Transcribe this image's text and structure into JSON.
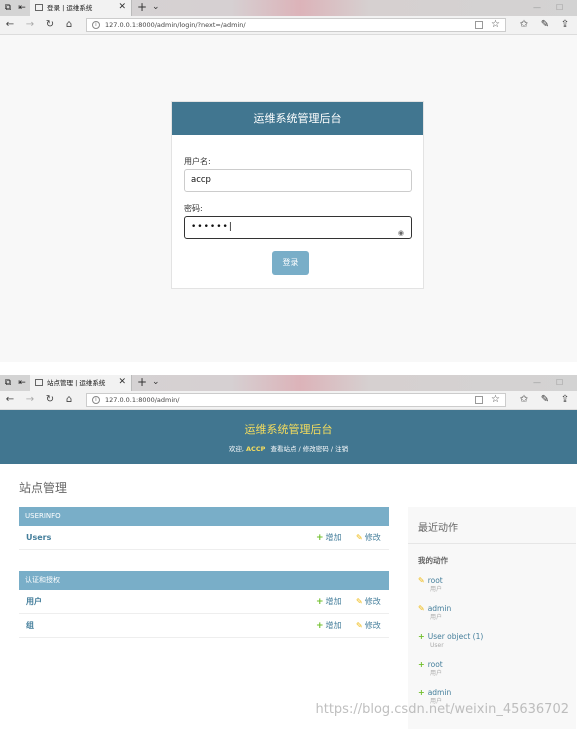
{
  "screen1": {
    "tab_title": "登录 | 运维系统",
    "url": "127.0.0.1:8000/admin/login/?next=/admin/",
    "login": {
      "header_title": "运维系统管理后台",
      "username_label": "用户名:",
      "username_value": "accp",
      "password_label": "密码:",
      "password_value": "••••••",
      "submit_label": "登录"
    }
  },
  "screen2": {
    "tab_title": "站点管理 | 运维系统",
    "url": "127.0.0.1:8000/admin/",
    "header": {
      "branding": "运维系统管理后台",
      "welcome": "欢迎,",
      "username": "ACCP",
      "view_site": "查看站点",
      "change_password": "修改密码",
      "logout": "注销",
      "separator": " / "
    },
    "page_title": "站点管理",
    "modules": [
      {
        "caption": "USERINFO",
        "models": [
          {
            "name": "Users",
            "add": "增加",
            "change": "修改"
          }
        ]
      },
      {
        "caption": "认证和授权",
        "models": [
          {
            "name": "用户",
            "add": "增加",
            "change": "修改"
          },
          {
            "name": "组",
            "add": "增加",
            "change": "修改"
          }
        ]
      }
    ],
    "recent": {
      "title": "最近动作",
      "subtitle": "我的动作",
      "actions": [
        {
          "kind": "change",
          "name": "root",
          "type": "用户"
        },
        {
          "kind": "change",
          "name": "admin",
          "type": "用户"
        },
        {
          "kind": "add",
          "name": "User object (1)",
          "type": "User"
        },
        {
          "kind": "add",
          "name": "root",
          "type": "用户"
        },
        {
          "kind": "add",
          "name": "admin",
          "type": "用户"
        }
      ]
    }
  },
  "watermark": "https://blog.csdn.net/weixin_45636702",
  "colors": {
    "header": "#417690",
    "branding": "#f5dd5d",
    "caption": "#79aec8",
    "link": "#447e9b",
    "add": "#70bf2b",
    "change": "#efb80b"
  }
}
